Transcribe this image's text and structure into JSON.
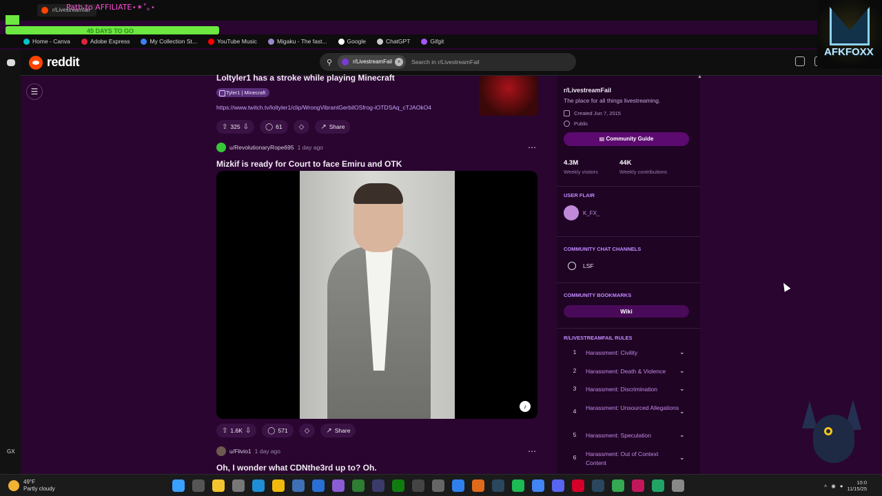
{
  "browser": {
    "current_tab": "r/Livestreamfail",
    "overlay_title": "Path to AFFILIATE⋆✴︎˚｡⋆",
    "overlay_counter": "45 DAYS TO GO",
    "bookmarks": [
      {
        "label": "Home - Canva",
        "color": "#00c4cc"
      },
      {
        "label": "Adobe Express",
        "color": "#e0243b"
      },
      {
        "label": "My Collection St...",
        "color": "#3b82f6"
      },
      {
        "label": "YouTube Music",
        "color": "#ff0000"
      },
      {
        "label": "Migaku - The fast...",
        "color": "#9b87c9"
      },
      {
        "label": "Google",
        "color": "#ffffff"
      },
      {
        "label": "ChatGPT",
        "color": "#cccccc"
      },
      {
        "label": "Gifgit",
        "color": "#a855f7"
      }
    ]
  },
  "header": {
    "logo_text": "reddit",
    "search_chip": "r/LivestreamFail",
    "search_placeholder": "Search in r/LivestreamFail"
  },
  "feed": {
    "post1": {
      "title": "Loltyler1 has a stroke while playing Minecraft",
      "flair": "Tyler1 | Minecraft",
      "link": "https://www.twitch.tv/loltyler1/clip/WrongVibrantGerbilOSfrog-iOTDSAq_cTJAOkO4",
      "votes": "325",
      "comments": "61",
      "share": "Share"
    },
    "post2": {
      "author": "u/RevolutionaryRope695",
      "time": "1 day ago",
      "title": "Mizkif is ready for Court to face Emiru and OTK",
      "votes": "1.6K",
      "comments": "571",
      "share": "Share"
    },
    "post3": {
      "author": "u/Flivio1",
      "time": "1 day ago",
      "title": "Oh, I wonder what CDNthe3rd up to? Oh."
    }
  },
  "sidebar": {
    "name": "r/LivestreamFail",
    "description": "The place for all things livestreaming.",
    "created": "Created Jun 7, 2015",
    "visibility": "Public",
    "guide_button": "Community Guide",
    "visitors_value": "4.3M",
    "visitors_label": "Weekly visitors",
    "contrib_value": "44K",
    "contrib_label": "Weekly contributions",
    "user_flair_heading": "USER FLAIR",
    "user_flair_name": "K_FX_",
    "chat_heading": "COMMUNITY CHAT CHANNELS",
    "chat_channel": "LSF",
    "bookmarks_heading": "COMMUNITY BOOKMARKS",
    "wiki_button": "Wiki",
    "rules_heading": "R/LIVESTREAMFAIL RULES",
    "rules": [
      {
        "n": "1",
        "text": "Harassment: Civility"
      },
      {
        "n": "2",
        "text": "Harassment: Death & Violence"
      },
      {
        "n": "3",
        "text": "Harassment: Discrimination"
      },
      {
        "n": "4",
        "text": "Harassment: Unsourced Allegations"
      },
      {
        "n": "5",
        "text": "Harassment: Speculation"
      },
      {
        "n": "6",
        "text": "Harassment: Out of Context Content"
      }
    ]
  },
  "overlay": {
    "brand": "AFKFOXX"
  },
  "taskbar": {
    "temperature": "49°F",
    "condition": "Partly cloudy",
    "time": "10:0",
    "date": "11/15/25"
  },
  "misc": {
    "gx_label": "GX"
  }
}
